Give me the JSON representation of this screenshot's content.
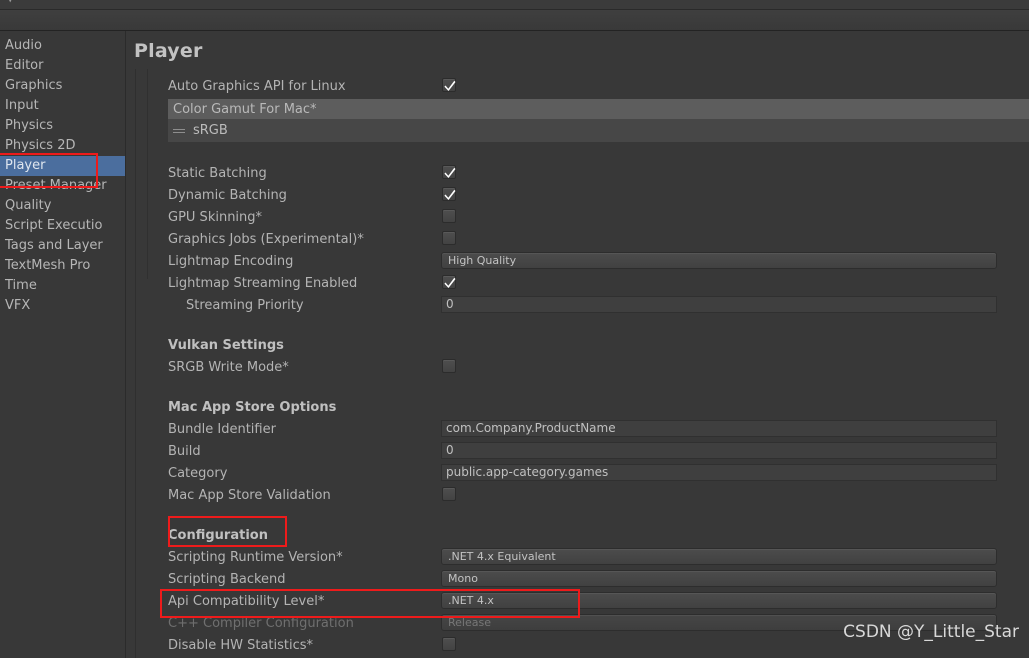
{
  "window": {
    "chrome_glyphs": "▼ ⌐ ⌐"
  },
  "sidebar": {
    "items": [
      {
        "label": "Audio",
        "selected": false
      },
      {
        "label": "Editor",
        "selected": false
      },
      {
        "label": "Graphics",
        "selected": false
      },
      {
        "label": "Input",
        "selected": false
      },
      {
        "label": "Physics",
        "selected": false
      },
      {
        "label": "Physics 2D",
        "selected": false
      },
      {
        "label": "Player",
        "selected": true
      },
      {
        "label": "Preset Manager",
        "selected": false
      },
      {
        "label": "Quality",
        "selected": false
      },
      {
        "label": "Script Executio",
        "selected": false
      },
      {
        "label": "Tags and Layer",
        "selected": false
      },
      {
        "label": "TextMesh Pro",
        "selected": false
      },
      {
        "label": "Time",
        "selected": false
      },
      {
        "label": "VFX",
        "selected": false
      }
    ]
  },
  "panel": {
    "title": "Player"
  },
  "rows": {
    "auto_graphics_api_linux": {
      "label": "Auto Graphics API  for Linux",
      "value": "checked"
    },
    "color_gamut_header": {
      "label": "Color Gamut For Mac*"
    },
    "color_gamut_item": {
      "label": "sRGB"
    },
    "static_batching": {
      "label": "Static Batching",
      "value": "checked"
    },
    "dynamic_batching": {
      "label": "Dynamic Batching",
      "value": "checked"
    },
    "gpu_skinning": {
      "label": "GPU Skinning*",
      "value": "unchecked"
    },
    "graphics_jobs": {
      "label": "Graphics Jobs (Experimental)*",
      "value": "unchecked"
    },
    "lightmap_encoding": {
      "label": "Lightmap Encoding",
      "value": "High Quality"
    },
    "lightmap_streaming": {
      "label": "Lightmap Streaming Enabled",
      "value": "checked"
    },
    "streaming_priority": {
      "label": "Streaming Priority",
      "value": "0"
    },
    "vulkan_settings_header": {
      "label": "Vulkan Settings"
    },
    "srgb_write_mode": {
      "label": "SRGB Write Mode*",
      "value": "unchecked"
    },
    "mac_app_store_header": {
      "label": "Mac App Store Options"
    },
    "bundle_identifier": {
      "label": "Bundle Identifier",
      "value": "com.Company.ProductName"
    },
    "build": {
      "label": "Build",
      "value": "0"
    },
    "category": {
      "label": "Category",
      "value": "public.app-category.games"
    },
    "mac_app_store_validation": {
      "label": "Mac App Store Validation",
      "value": "unchecked"
    },
    "configuration_header": {
      "label": "Configuration"
    },
    "scripting_runtime_version": {
      "label": "Scripting Runtime Version*",
      "value": ".NET 4.x Equivalent"
    },
    "scripting_backend": {
      "label": "Scripting Backend",
      "value": "Mono"
    },
    "api_compatibility_level": {
      "label": "Api Compatibility Level*",
      "value": ".NET 4.x"
    },
    "cpp_compiler_configuration": {
      "label": "C++ Compiler Configuration",
      "value": "Release"
    },
    "disable_hw_statistics": {
      "label": "Disable HW Statistics*",
      "value": "unchecked"
    }
  },
  "annotations": {
    "accent_color": "#ee1b1b",
    "boxes": [
      {
        "name": "player-sidebar-highlight"
      },
      {
        "name": "configuration-highlight"
      },
      {
        "name": "api-compatibility-level-highlight"
      }
    ]
  },
  "watermark": {
    "text": "CSDN @Y_Little_Star"
  },
  "colors": {
    "background": "#383838",
    "selection_blue": "#4b6e9e",
    "list_header": "#5d5d5d",
    "field_background": "#3f3f3f"
  }
}
